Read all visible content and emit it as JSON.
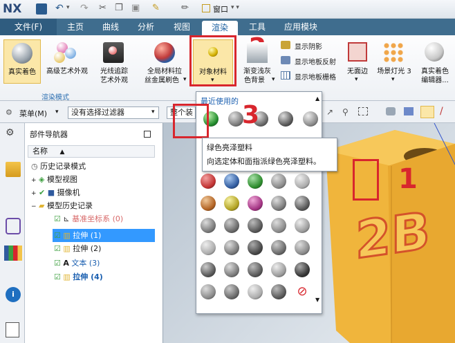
{
  "app": {
    "logo": "NX"
  },
  "quick_access": {
    "window_label": "窗口"
  },
  "menu_tabs": [
    {
      "label": "文件(F)"
    },
    {
      "label": "主页"
    },
    {
      "label": "曲线"
    },
    {
      "label": "分析"
    },
    {
      "label": "视图"
    },
    {
      "label": "渲染"
    },
    {
      "label": "工具"
    },
    {
      "label": "应用模块"
    }
  ],
  "ribbon": {
    "btn_true_shading": "真实着色",
    "btn_advanced_art_1": "高级艺术外观",
    "btn_raytrace_1": "光线追踪",
    "btn_raytrace_2": "艺术外观",
    "btn_global_material_1": "全局材料拉",
    "btn_global_material_2": "丝金属刷色",
    "btn_object_material": "对象材料",
    "btn_gradient_bg_1": "渐变浅灰",
    "btn_gradient_bg_2": "色背景",
    "btn_show_shadow": "显示阴影",
    "btn_show_floor_reflect": "显示地板反射",
    "btn_show_floor_grid": "显示地板栅格",
    "btn_no_edge": "无面边",
    "btn_scene_light": "场景灯光 3",
    "btn_true_shading_editor_1": "真实着色",
    "btn_true_shading_editor_2": "编辑器...",
    "group_label": "渲染模式"
  },
  "toolbar2": {
    "menu_label": "菜单(M)",
    "filter_value": "没有选择过滤器",
    "assembly_value": "整个装配"
  },
  "navigator": {
    "title": "部件导航器",
    "col_name": "名称",
    "items": [
      {
        "label": "历史记录模式",
        "color": "#1a1a1a"
      },
      {
        "label": "模型视图",
        "color": "#1a1a1a"
      },
      {
        "label": "摄像机",
        "color": "#1a1a1a"
      },
      {
        "label": "模型历史记录",
        "color": "#1a1a1a"
      },
      {
        "label": "基准坐标系 (0)",
        "color": "#d86a6a"
      },
      {
        "label": "拉伸 (1)",
        "color": "#ffffff"
      },
      {
        "label": "拉伸 (2)",
        "color": "#1a1a1a"
      },
      {
        "label": "文本 (3)",
        "color": "#1a5fb0"
      },
      {
        "label": "拉伸 (4)",
        "color": "#1a5fb0"
      }
    ]
  },
  "popup": {
    "recent_label": "最近使用的",
    "tooltip_title": "绿色亮泽塑料",
    "tooltip_desc": "向选定体和面指派绿色亮泽塑料。"
  },
  "annotations": {
    "n1": "1",
    "n2": "2",
    "n3": "3"
  },
  "viewport": {
    "part_text": "2B"
  },
  "colors": {
    "accent": "#3f6d8e",
    "highlight_red": "#d8262d",
    "part_orange": "#f0b53c"
  }
}
